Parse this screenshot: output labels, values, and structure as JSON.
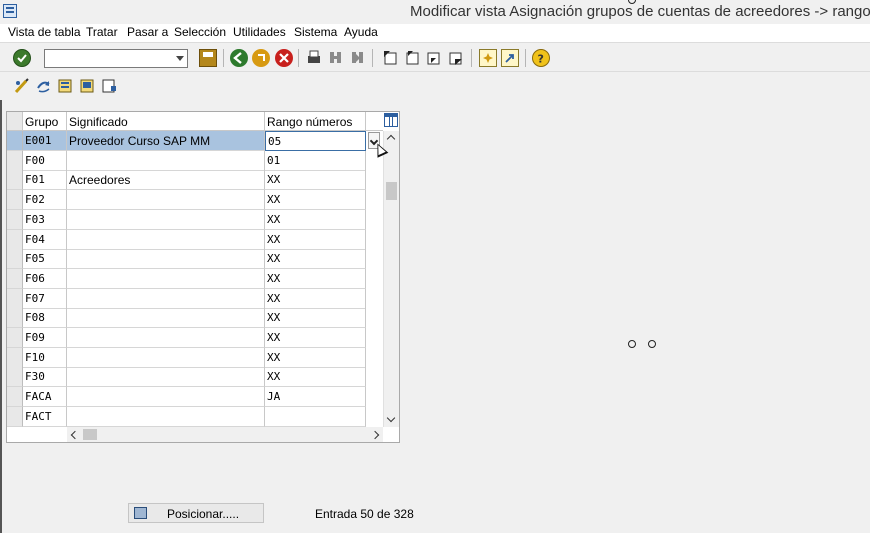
{
  "window": {
    "title": "Modificar vista Asignación grupos de cuentas de acreedores -> rango de"
  },
  "menu": [
    "Vista de tabla",
    "Tratar",
    "Pasar a",
    "Selección",
    "Utilidades",
    "Sistema",
    "Ayuda"
  ],
  "command_field": {
    "value": "",
    "placeholder": ""
  },
  "table": {
    "headers": {
      "grupo": "Grupo",
      "significado": "Significado",
      "rango": "Rango números"
    },
    "rows": [
      {
        "grupo": "E001",
        "significado": "Proveedor Curso SAP MM",
        "rango": "05"
      },
      {
        "grupo": "F00",
        "significado": "",
        "rango": "01"
      },
      {
        "grupo": "F01",
        "significado": "Acreedores",
        "rango": "XX"
      },
      {
        "grupo": "F02",
        "significado": "",
        "rango": "XX"
      },
      {
        "grupo": "F03",
        "significado": "",
        "rango": "XX"
      },
      {
        "grupo": "F04",
        "significado": "",
        "rango": "XX"
      },
      {
        "grupo": "F05",
        "significado": "",
        "rango": "XX"
      },
      {
        "grupo": "F06",
        "significado": "",
        "rango": "XX"
      },
      {
        "grupo": "F07",
        "significado": "",
        "rango": "XX"
      },
      {
        "grupo": "F08",
        "significado": "",
        "rango": "XX"
      },
      {
        "grupo": "F09",
        "significado": "",
        "rango": "XX"
      },
      {
        "grupo": "F10",
        "significado": "",
        "rango": "XX"
      },
      {
        "grupo": "F30",
        "significado": "",
        "rango": "XX"
      },
      {
        "grupo": "FACA",
        "significado": "",
        "rango": "JA"
      },
      {
        "grupo": "FACT",
        "significado": "",
        "rango": ""
      }
    ]
  },
  "footer": {
    "position_button": "Posicionar.....",
    "entry_text": "Entrada 50 de 328"
  },
  "icons": {
    "toolbar1": [
      "enter-check-icon",
      "save-icon",
      "back-icon",
      "exit-icon",
      "cancel-icon",
      "print-icon",
      "find-icon",
      "find-next-icon",
      "first-page-icon",
      "previous-page-icon",
      "next-page-icon",
      "last-page-icon",
      "create-session-icon",
      "shortcut-icon",
      "help-icon"
    ],
    "toolbar2": [
      "display-change-icon",
      "other-view-icon",
      "select-all-icon",
      "select-block-icon",
      "deselect-all-icon"
    ]
  },
  "colors": {
    "selected_row": "#a9c3df",
    "background": "#f0f0f0"
  }
}
